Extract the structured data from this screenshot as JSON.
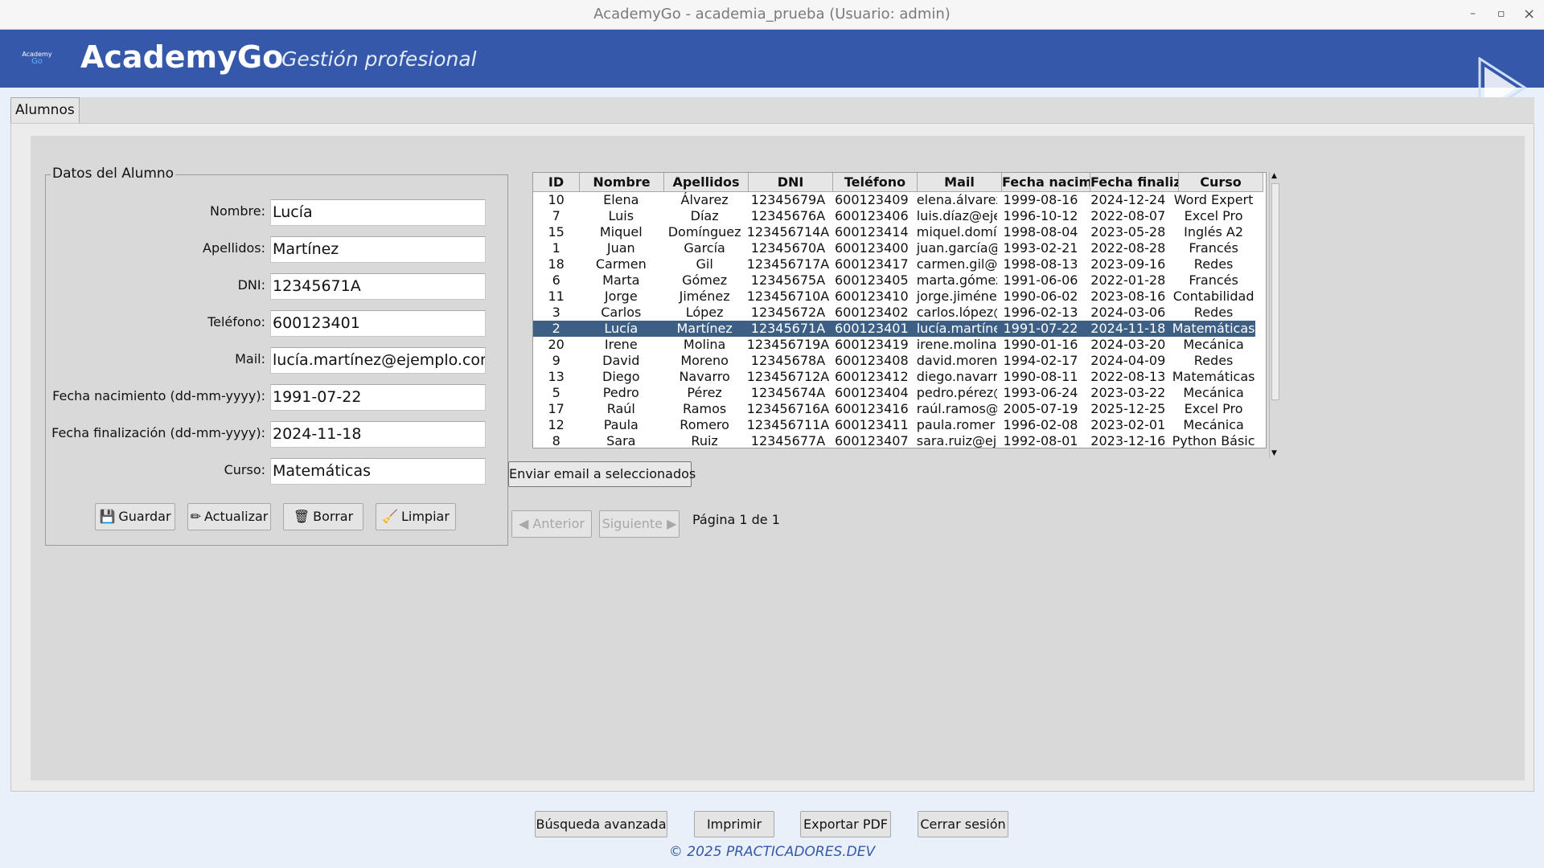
{
  "window": {
    "title": "AcademyGo - academia_prueba (Usuario: admin)",
    "minimize": "–",
    "maximize": "▫",
    "close": "×"
  },
  "header": {
    "logo_top": "Academy",
    "logo_bottom": "Go",
    "title": "AcademyGo",
    "subtitle": "Gestión profesional"
  },
  "tabs": [
    {
      "label": "Alumnos"
    }
  ],
  "form": {
    "legend": "Datos del Alumno",
    "fields": [
      {
        "label": "Nombre:",
        "value": "Lucía"
      },
      {
        "label": "Apellidos:",
        "value": "Martínez"
      },
      {
        "label": "DNI:",
        "value": "12345671A"
      },
      {
        "label": "Teléfono:",
        "value": "600123401"
      },
      {
        "label": "Mail:",
        "value": "lucía.martínez@ejemplo.com"
      },
      {
        "label": "Fecha nacimiento (dd-mm-yyyy):",
        "value": "1991-07-22"
      },
      {
        "label": "Fecha finalización (dd-mm-yyyy):",
        "value": "2024-11-18"
      },
      {
        "label": "Curso:",
        "value": "Matemáticas"
      }
    ],
    "buttons": {
      "save": {
        "icon": "💾",
        "label": "Guardar"
      },
      "update": {
        "icon": "✏",
        "label": "Actualizar"
      },
      "delete": {
        "icon": "🗑",
        "label": "Borrar"
      },
      "clear": {
        "icon": "🧹",
        "label": "Limpiar"
      }
    }
  },
  "table": {
    "columns": [
      "ID",
      "Nombre",
      "Apellidos",
      "DNI",
      "Teléfono",
      "Mail",
      "Fecha nacimi",
      "Fecha finaliz",
      "Curso"
    ],
    "rows": [
      [
        "10",
        "Elena",
        "Álvarez",
        "12345679A",
        "600123409",
        "elena.álvarez",
        "1999-08-16",
        "2024-12-24",
        "Word Expert"
      ],
      [
        "7",
        "Luis",
        "Díaz",
        "12345676A",
        "600123406",
        "luis.díaz@eje",
        "1996-10-12",
        "2022-08-07",
        "Excel Pro"
      ],
      [
        "15",
        "Miquel",
        "Domínguez",
        "123456714A",
        "600123414",
        "miquel.domí",
        "1998-08-04",
        "2023-05-28",
        "Inglés A2"
      ],
      [
        "1",
        "Juan",
        "García",
        "12345670A",
        "600123400",
        "juan.garcía@",
        "1993-02-21",
        "2022-08-28",
        "Francés"
      ],
      [
        "18",
        "Carmen",
        "Gil",
        "123456717A",
        "600123417",
        "carmen.gil@",
        "1998-08-13",
        "2023-09-16",
        "Redes"
      ],
      [
        "6",
        "Marta",
        "Gómez",
        "12345675A",
        "600123405",
        "marta.gómez",
        "1991-06-06",
        "2022-01-28",
        "Francés"
      ],
      [
        "11",
        "Jorge",
        "Jiménez",
        "123456710A",
        "600123410",
        "jorge.jiméne",
        "1990-06-02",
        "2023-08-16",
        "Contabilidad"
      ],
      [
        "3",
        "Carlos",
        "López",
        "12345672A",
        "600123402",
        "carlos.lópez@",
        "1996-02-13",
        "2024-03-06",
        "Redes"
      ],
      [
        "2",
        "Lucía",
        "Martínez",
        "12345671A",
        "600123401",
        "lucía.martíne",
        "1991-07-22",
        "2024-11-18",
        "Matemáticas"
      ],
      [
        "20",
        "Irene",
        "Molina",
        "123456719A",
        "600123419",
        "irene.molina",
        "1990-01-16",
        "2024-03-20",
        "Mecánica"
      ],
      [
        "9",
        "David",
        "Moreno",
        "12345678A",
        "600123408",
        "david.moren",
        "1994-02-17",
        "2024-04-09",
        "Redes"
      ],
      [
        "13",
        "Diego",
        "Navarro",
        "123456712A",
        "600123412",
        "diego.navarr",
        "1990-08-11",
        "2022-08-13",
        "Matemáticas"
      ],
      [
        "5",
        "Pedro",
        "Pérez",
        "12345674A",
        "600123404",
        "pedro.pérez@",
        "1993-06-24",
        "2023-03-22",
        "Mecánica"
      ],
      [
        "17",
        "Raúl",
        "Ramos",
        "123456716A",
        "600123416",
        "raúl.ramos@",
        "2005-07-19",
        "2025-12-25",
        "Excel Pro"
      ],
      [
        "12",
        "Paula",
        "Romero",
        "123456711A",
        "600123411",
        "paula.romer",
        "1996-02-08",
        "2023-02-01",
        "Mecánica"
      ],
      [
        "8",
        "Sara",
        "Ruiz",
        "12345677A",
        "600123407",
        "sara.ruiz@eje",
        "1992-08-01",
        "2023-12-16",
        "Python Básic"
      ]
    ],
    "selected_row": 8,
    "scroll_up": "▲",
    "scroll_down": "▼"
  },
  "actions": {
    "email_selected": "Enviar email a seleccionados",
    "prev": "◀ Anterior",
    "next": "Siguiente ▶",
    "page_info": "Página 1 de 1"
  },
  "bottom": {
    "advanced_search": "Búsqueda avanzada",
    "print": "Imprimir",
    "export_pdf": "Exportar PDF",
    "logout": "Cerrar sesión"
  },
  "footer": "© 2025 PRACTICADORES.DEV",
  "colors": {
    "header_bg": "#3558aa",
    "selected_row_bg": "#3d5f86",
    "footer_text": "#3558aa"
  }
}
